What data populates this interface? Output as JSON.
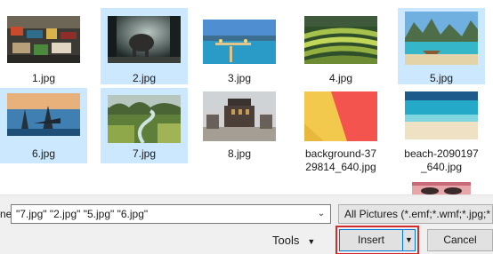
{
  "files": [
    {
      "caption": "1.jpg",
      "selected": false
    },
    {
      "caption": "2.jpg",
      "selected": true
    },
    {
      "caption": "3.jpg",
      "selected": false
    },
    {
      "caption": "4.jpg",
      "selected": false
    },
    {
      "caption": "5.jpg",
      "selected": true
    },
    {
      "caption": "6.jpg",
      "selected": true
    },
    {
      "caption": "7.jpg",
      "selected": true
    },
    {
      "caption": "8.jpg",
      "selected": false
    },
    {
      "caption_line1": "background-37",
      "caption_line2": "29814_640.jpg",
      "selected": false
    },
    {
      "caption_line1": "beach-2090197",
      "caption_line2": "_640.jpg",
      "selected": false
    }
  ],
  "footer": {
    "file_name_label": "ne:",
    "file_name_value": "\"7.jpg\" \"2.jpg\" \"5.jpg\" \"6.jpg\"",
    "file_type_value": "All Pictures (*.emf;*.wmf;*.jpg;*",
    "tools_label": "Tools",
    "insert_label": "Insert",
    "cancel_label": "Cancel"
  },
  "colors": {
    "selection": "#cce8ff",
    "highlight_box": "#d42b2b",
    "focus_border": "#0078d7"
  }
}
